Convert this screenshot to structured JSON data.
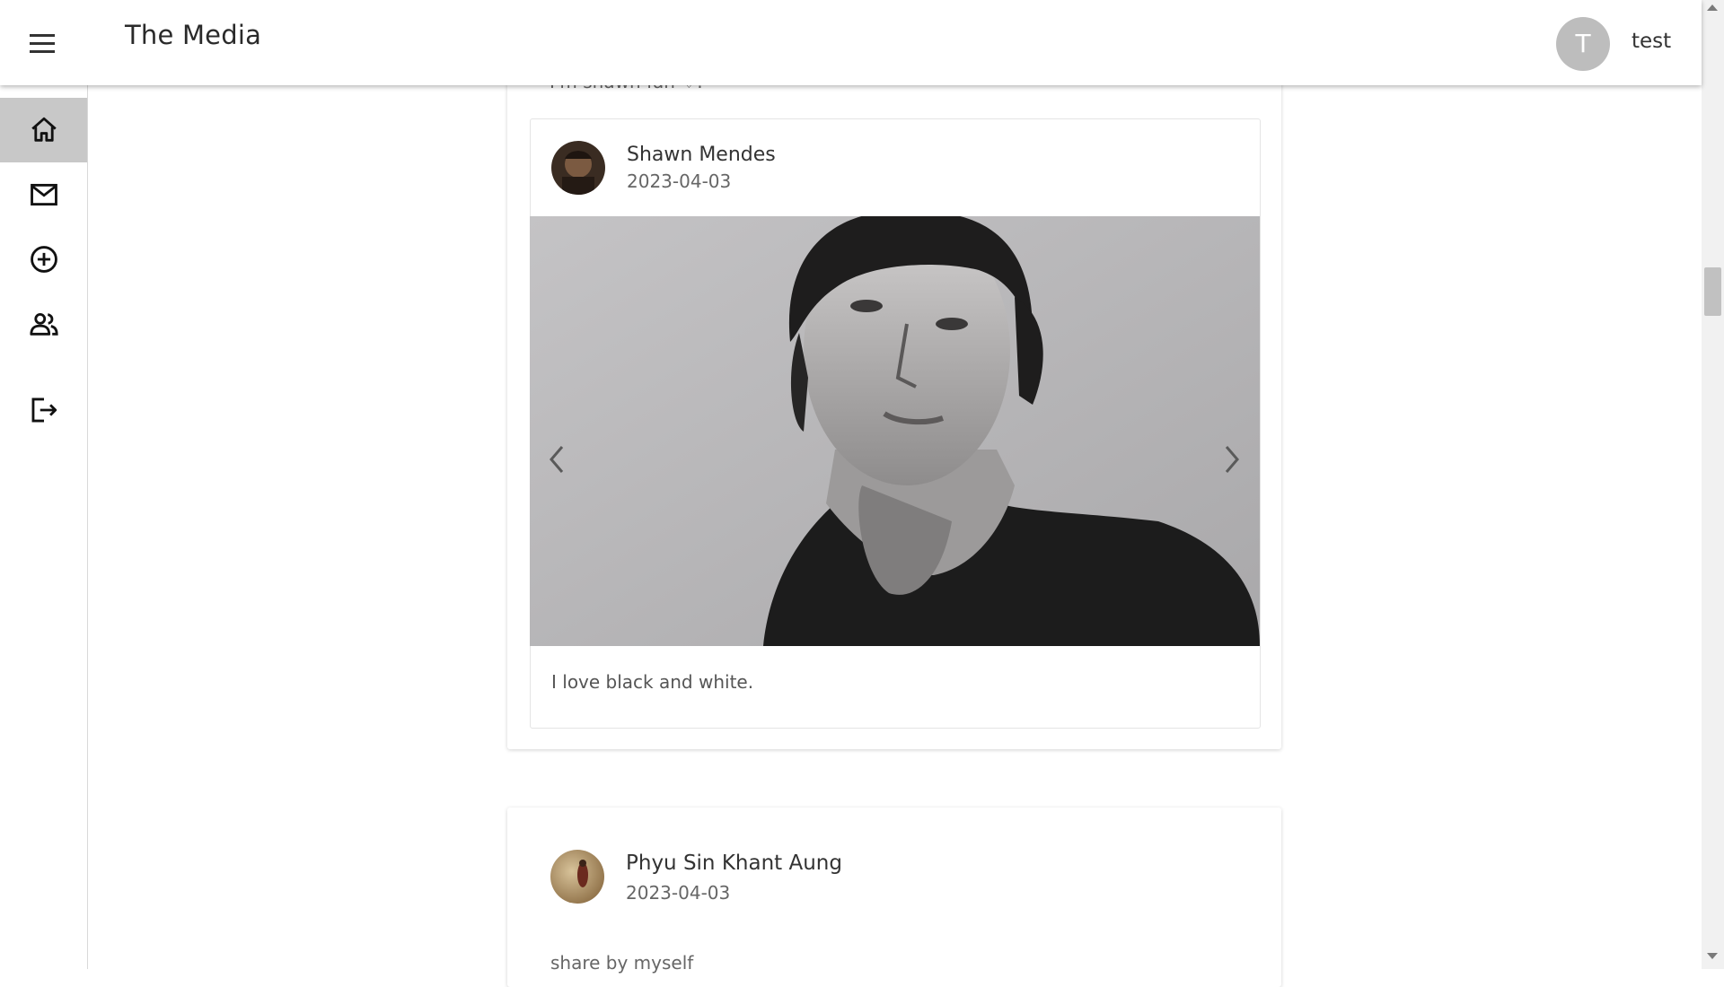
{
  "header": {
    "title": "The Media",
    "avatar_initial": "T",
    "username": "test"
  },
  "sidebar": {
    "items": [
      {
        "icon": "home-icon",
        "active": true
      },
      {
        "icon": "mail-icon",
        "active": false
      },
      {
        "icon": "add-circle-icon",
        "active": false
      },
      {
        "icon": "people-icon",
        "active": false
      },
      {
        "icon": "logout-icon",
        "active": false
      }
    ]
  },
  "feed": {
    "post1_cut_text": "I'm shawn fan ♡.",
    "shared_post": {
      "author": "Shawn Mendes",
      "date": "2023-04-03",
      "caption": "I love black and white."
    },
    "post2": {
      "author": "Phyu Sin Khant Aung",
      "date": "2023-04-03",
      "text": "share by myself"
    }
  },
  "colors": {
    "active_nav": "#c8c8c8",
    "avatar_bg": "#bdbdbd"
  }
}
